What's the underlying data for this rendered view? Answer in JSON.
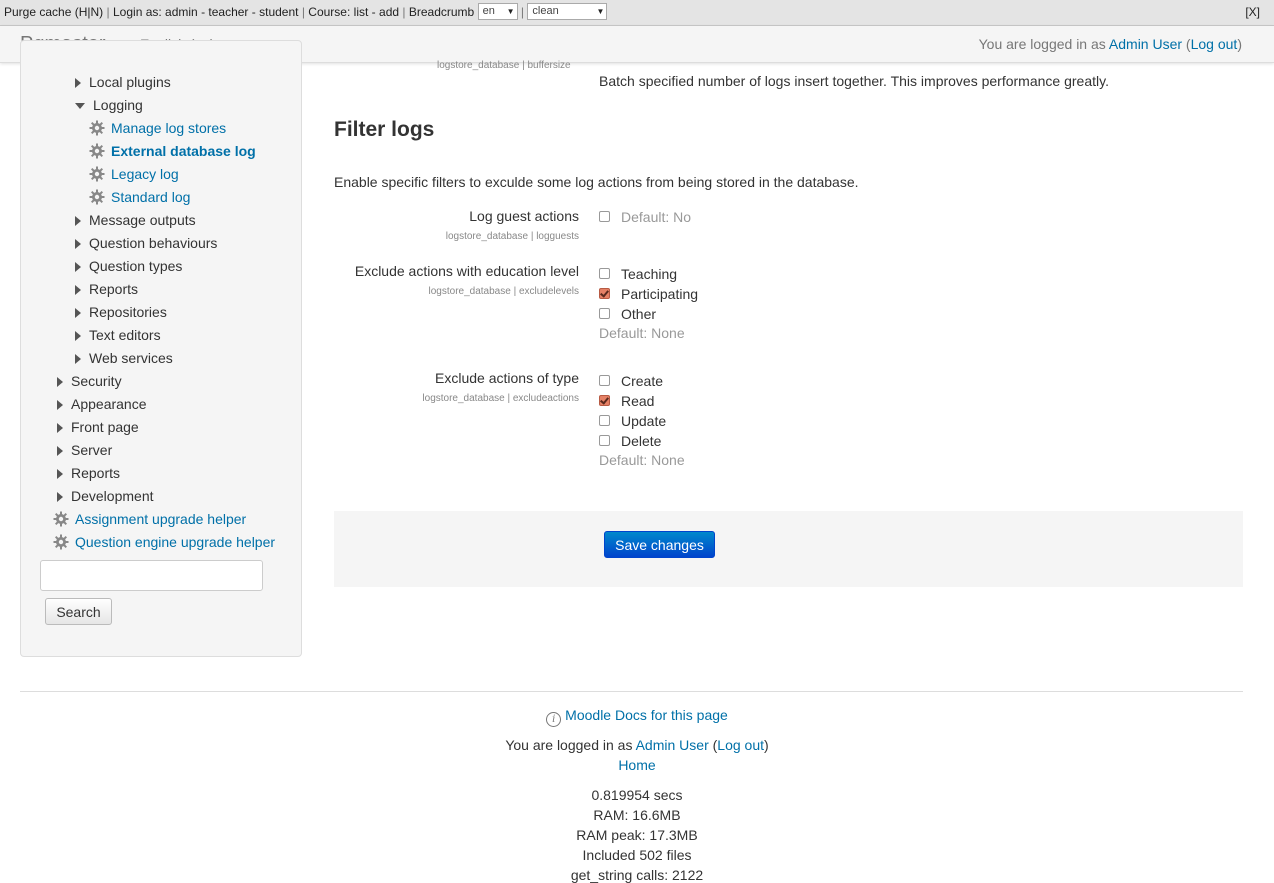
{
  "debug_bar": {
    "purge_cache": "Purge cache",
    "hn": "(H|N)",
    "login_as": "Login as:",
    "admin": "admin",
    "teacher": "teacher",
    "student": "student",
    "course": "Course:",
    "list": "list",
    "add": "add",
    "breadcrumb": "Breadcrumb",
    "lang_select": "en",
    "theme_select": "clean",
    "close": "[X]"
  },
  "navbar": {
    "brand": "Pgmaster",
    "language": "English (en)",
    "logged_in_prefix": "You are logged in as",
    "user": "Admin User",
    "logout": "Log out"
  },
  "sidebar": {
    "items": [
      {
        "label": "Local plugins",
        "level": 2,
        "kind": "collapsed"
      },
      {
        "label": "Logging",
        "level": 2,
        "kind": "expanded"
      },
      {
        "label": "Manage log stores",
        "level": 3,
        "kind": "link"
      },
      {
        "label": "External database log",
        "level": 3,
        "kind": "link",
        "current": true
      },
      {
        "label": "Legacy log",
        "level": 3,
        "kind": "link"
      },
      {
        "label": "Standard log",
        "level": 3,
        "kind": "link"
      },
      {
        "label": "Message outputs",
        "level": 2,
        "kind": "collapsed"
      },
      {
        "label": "Question behaviours",
        "level": 2,
        "kind": "collapsed"
      },
      {
        "label": "Question types",
        "level": 2,
        "kind": "collapsed"
      },
      {
        "label": "Reports",
        "level": 2,
        "kind": "collapsed"
      },
      {
        "label": "Repositories",
        "level": 2,
        "kind": "collapsed"
      },
      {
        "label": "Text editors",
        "level": 2,
        "kind": "collapsed"
      },
      {
        "label": "Web services",
        "level": 2,
        "kind": "collapsed"
      },
      {
        "label": "Security",
        "level": 1,
        "kind": "collapsed"
      },
      {
        "label": "Appearance",
        "level": 1,
        "kind": "collapsed"
      },
      {
        "label": "Front page",
        "level": 1,
        "kind": "collapsed"
      },
      {
        "label": "Server",
        "level": 1,
        "kind": "collapsed"
      },
      {
        "label": "Reports",
        "level": 1,
        "kind": "collapsed"
      },
      {
        "label": "Development",
        "level": 1,
        "kind": "collapsed"
      },
      {
        "label": "Assignment upgrade helper",
        "level": 1,
        "kind": "link"
      },
      {
        "label": "Question engine upgrade helper",
        "level": 1,
        "kind": "link"
      }
    ],
    "search_value": "",
    "search_button": "Search"
  },
  "main": {
    "partial_setting_key": "logstore_database | buffersize",
    "partial_setting_desc": "Batch specified number of logs insert together. This improves performance greatly.",
    "section_title": "Filter logs",
    "section_desc": "Enable specific filters to exculde some log actions from being stored in the database.",
    "settings": {
      "guests": {
        "label": "Log guest actions",
        "key": "logstore_database | logguests",
        "default": "Default: No",
        "checked": false
      },
      "levels": {
        "label": "Exclude actions with education level",
        "key": "logstore_database | excludelevels",
        "options": [
          {
            "label": "Teaching",
            "checked": false
          },
          {
            "label": "Participating",
            "checked": true
          },
          {
            "label": "Other",
            "checked": false
          }
        ],
        "default": "Default: None"
      },
      "actions": {
        "label": "Exclude actions of type",
        "key": "logstore_database | excludeactions",
        "options": [
          {
            "label": "Create",
            "checked": false
          },
          {
            "label": "Read",
            "checked": true
          },
          {
            "label": "Update",
            "checked": false
          },
          {
            "label": "Delete",
            "checked": false
          }
        ],
        "default": "Default: None"
      }
    },
    "save_button": "Save changes"
  },
  "footer": {
    "docs_link": "Moodle Docs for this page",
    "logged_in_prefix": "You are logged in as",
    "user": "Admin User",
    "logout": "Log out",
    "home": "Home",
    "perf": {
      "time": "0.819954 secs",
      "ram": "RAM: 16.6MB",
      "ram_peak": "RAM peak: 17.3MB",
      "files": "Included 502 files",
      "strings": "get_string calls: 2122"
    }
  },
  "colors": {
    "link": "#0070a8",
    "primary_button": "#0055cc",
    "checked_box": "#e58166"
  }
}
